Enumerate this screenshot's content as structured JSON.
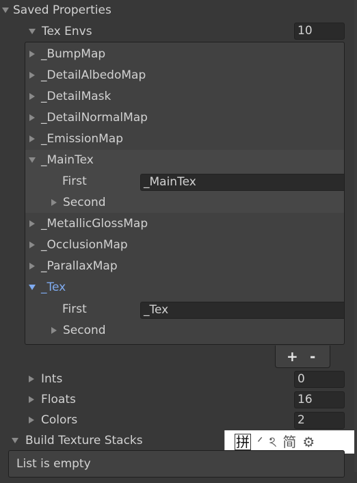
{
  "saved_properties": {
    "label": "Saved Properties"
  },
  "tex_envs": {
    "label": "Tex Envs",
    "size": "10",
    "items": [
      {
        "label": "_BumpMap"
      },
      {
        "label": "_DetailAlbedoMap"
      },
      {
        "label": "_DetailMask"
      },
      {
        "label": "_DetailNormalMap"
      },
      {
        "label": "_EmissionMap"
      },
      {
        "label": "_MainTex",
        "first_label": "First",
        "first_value": "_MainTex",
        "second_label": "Second"
      },
      {
        "label": "_MetallicGlossMap"
      },
      {
        "label": "_OcclusionMap"
      },
      {
        "label": "_ParallaxMap"
      },
      {
        "label": "_Tex",
        "first_label": "First",
        "first_value": "_Tex",
        "second_label": "Second"
      }
    ],
    "add_label": "+",
    "remove_label": "-"
  },
  "ints": {
    "label": "Ints",
    "value": "0"
  },
  "floats": {
    "label": "Floats",
    "value": "16"
  },
  "colors_prop": {
    "label": "Colors",
    "value": "2"
  },
  "build_texture_stacks": {
    "label": "Build Texture Stacks",
    "empty_text": "List is empty"
  },
  "ime_toolbar": {
    "glyphs": [
      "拼",
      "ᐟ",
      "ঽ",
      "简",
      "⚙"
    ]
  },
  "colors": {
    "background": "#383838",
    "field": "#2a2a2a",
    "selected_text": "#7fabf0"
  }
}
